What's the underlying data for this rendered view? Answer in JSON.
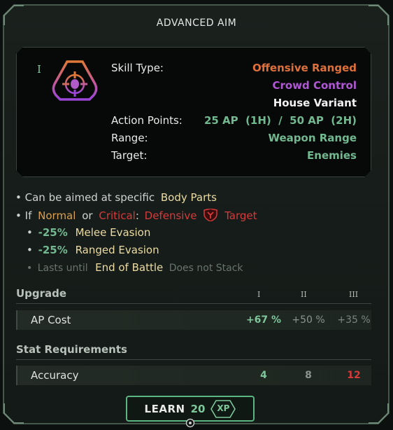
{
  "title": "ADVANCED AIM",
  "tier_marker": "I",
  "icon": "crosshair-hexagon-icon",
  "stats": [
    {
      "label": "Skill Type:",
      "value": "Offensive Ranged",
      "color": "#e0703a"
    },
    {
      "label": "",
      "value": "Crowd Control",
      "color": "#b157d6"
    },
    {
      "label": "",
      "value": "House Variant",
      "color": "#f2f2f2"
    },
    {
      "label": "Action Points:",
      "value": "25 AP  (1H)  /  50 AP  (2H)",
      "color": "#72b890"
    },
    {
      "label": "Range:",
      "value": "Weapon Range",
      "color": "#72b890"
    },
    {
      "label": "Target:",
      "value": "Enemies",
      "color": "#72b890"
    }
  ],
  "description": {
    "line1": {
      "bullet": "•",
      "text": "Can be aimed at specific",
      "highlight": "Body Parts"
    },
    "line2": {
      "bullet": "•",
      "prefix": "If",
      "normal": "Normal",
      "or": "or",
      "critical": "Critical",
      "colon": ":",
      "defensive": "Defensive",
      "target": "Target"
    },
    "line3": {
      "bullet": "•",
      "value": "-25%",
      "text": "Melee Evasion"
    },
    "line4": {
      "bullet": "•",
      "value": "-25%",
      "text": "Ranged Evasion"
    },
    "line5": {
      "bullet": "•",
      "prefix": "Lasts until",
      "highlight": "End of Battle",
      "suffix": "Does not Stack"
    }
  },
  "upgrade": {
    "heading": "Upgrade",
    "tiers": [
      "I",
      "II",
      "III"
    ],
    "rows": [
      {
        "label": "AP Cost",
        "values": [
          "+67 %",
          "+50 %",
          "+35 %"
        ],
        "colors": [
          "#7ec79a",
          "#8a958e",
          "#7a857e"
        ]
      }
    ]
  },
  "requirements": {
    "heading": "Stat Requirements",
    "rows": [
      {
        "label": "Accuracy",
        "values": [
          "4",
          "8",
          "12"
        ],
        "colors": [
          "#7ec79a",
          "#8a958e",
          "#d63a3a"
        ]
      }
    ]
  },
  "learn": {
    "label": "LEARN",
    "cost": "20",
    "unit": "XP"
  }
}
